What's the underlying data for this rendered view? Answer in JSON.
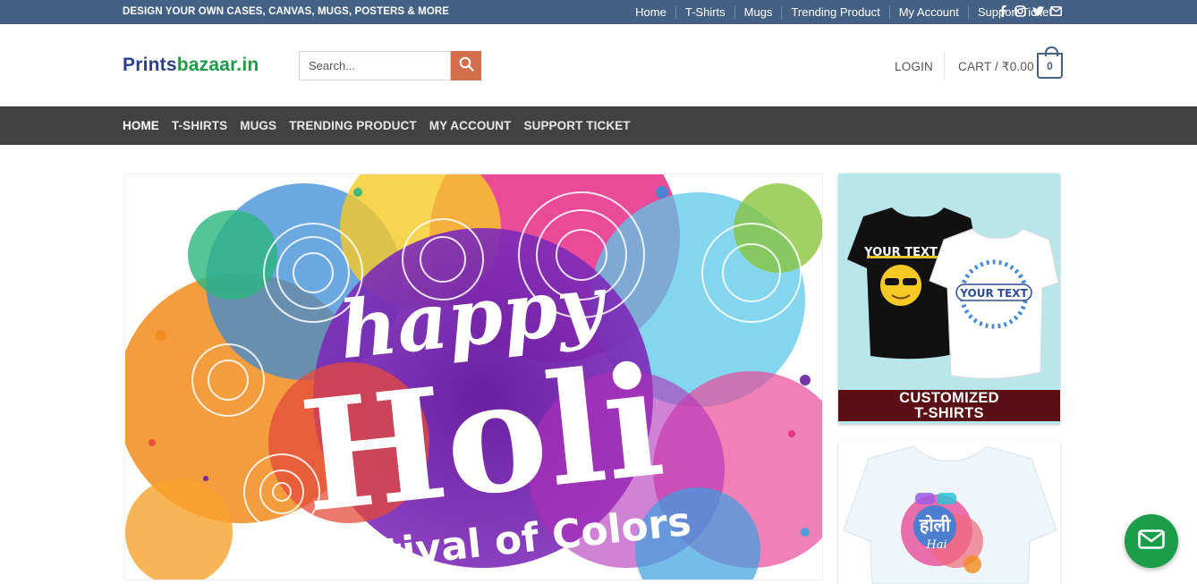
{
  "topbar": {
    "tagline": "DESIGN YOUR OWN CASES, CANVAS, MUGS, POSTERS & MORE",
    "nav": [
      "Home",
      "T-Shirts",
      "Mugs",
      "Trending Product",
      "My Account",
      "Support Ticket"
    ],
    "social_icons": [
      "facebook-icon",
      "instagram-icon",
      "twitter-icon",
      "email-icon"
    ]
  },
  "header": {
    "logo_part1": "Prints",
    "logo_part2": "bazaar.in",
    "search_placeholder": "Search...",
    "login_label": "LOGIN",
    "cart_label": "CART / ₹0.00",
    "cart_count": "0"
  },
  "mainnav": {
    "items": [
      "HOME",
      "T-SHIRTS",
      "MUGS",
      "TRENDING PRODUCT",
      "MY ACCOUNT",
      "SUPPORT TICKET"
    ]
  },
  "hero": {
    "line1": "happy",
    "line2": "Holi",
    "line3": "Festival of Colors"
  },
  "cards": {
    "card1": {
      "shirt_text_black": "YOUR TEXT",
      "shirt_text_white": "YOUR TEXT",
      "label_line1": "CUSTOMIZED",
      "label_line2": "T-SHIRTS"
    },
    "card2": {
      "shirt_text": "होली",
      "shirt_text_small": "Hai"
    }
  },
  "colors": {
    "topbar": "#446084",
    "accent": "#d26e4b",
    "nav": "#424242",
    "logo_blue": "#2b3f86",
    "logo_green": "#1f9a49",
    "fab": "#1a9e4a"
  }
}
